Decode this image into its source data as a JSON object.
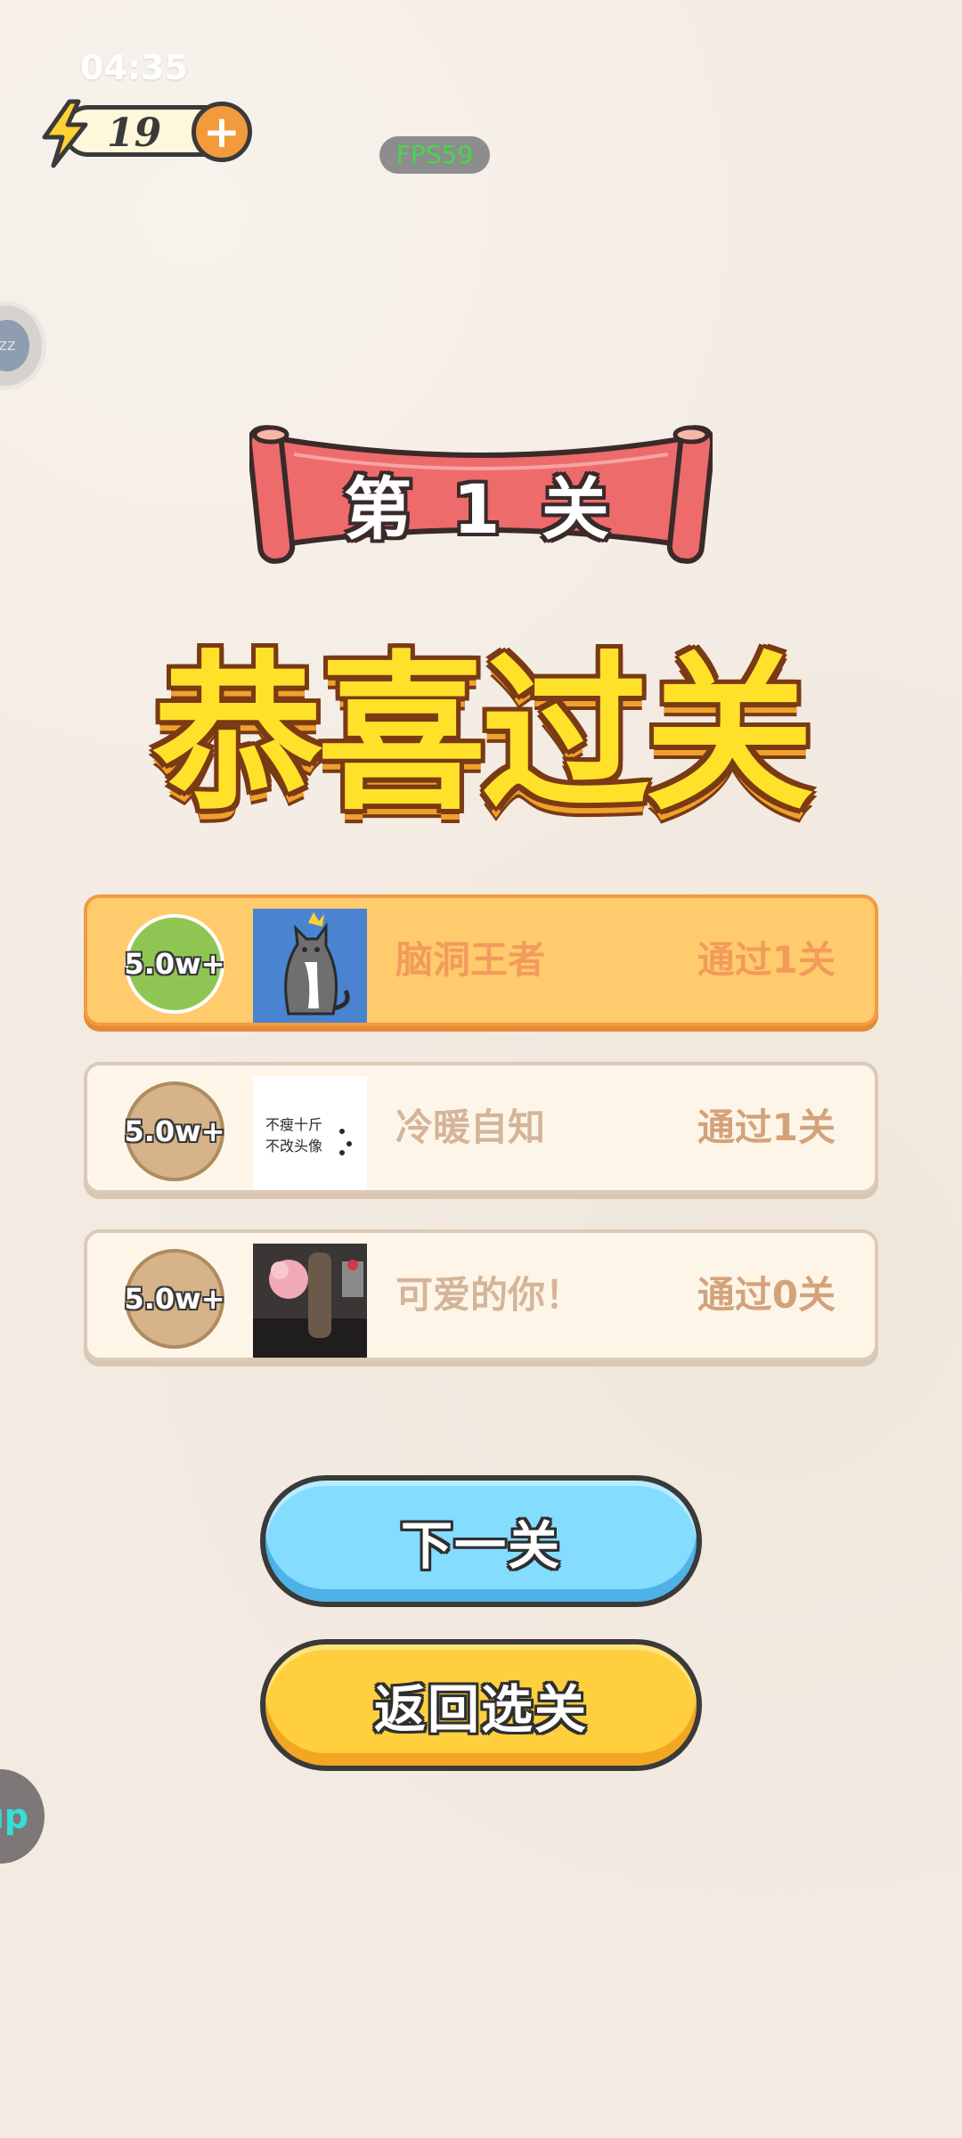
{
  "status": {
    "time": "04:35"
  },
  "energy": {
    "count": "19",
    "plus": "+"
  },
  "debug": {
    "fps": "FPS59"
  },
  "side": {
    "bubble_text": "zz",
    "up_text": "up"
  },
  "level": {
    "title": "第 1 关"
  },
  "headline": "恭喜过关",
  "ranking": [
    {
      "badge": "5.0w+",
      "name": "脑洞王者",
      "score": "通过1关"
    },
    {
      "badge": "5.0w+",
      "name": "冷暖自知",
      "score": "通过1关",
      "avatar_text": [
        "不瘦十斤",
        "不改头像"
      ]
    },
    {
      "badge": "5.0w+",
      "name": "可爱的你！",
      "score": "通过0关"
    }
  ],
  "buttons": {
    "next": "下一关",
    "back": "返回选关"
  },
  "colors": {
    "background": "#f3ebe2",
    "headline_fill": "#ffe12a",
    "banner_red": "#ee6b6b",
    "first_row": "#ffcb6c",
    "next_button": "#84dcff",
    "back_button": "#ffcf3e"
  },
  "icons": {
    "energy": "lightning-bolt-icon",
    "plus": "plus-icon"
  }
}
